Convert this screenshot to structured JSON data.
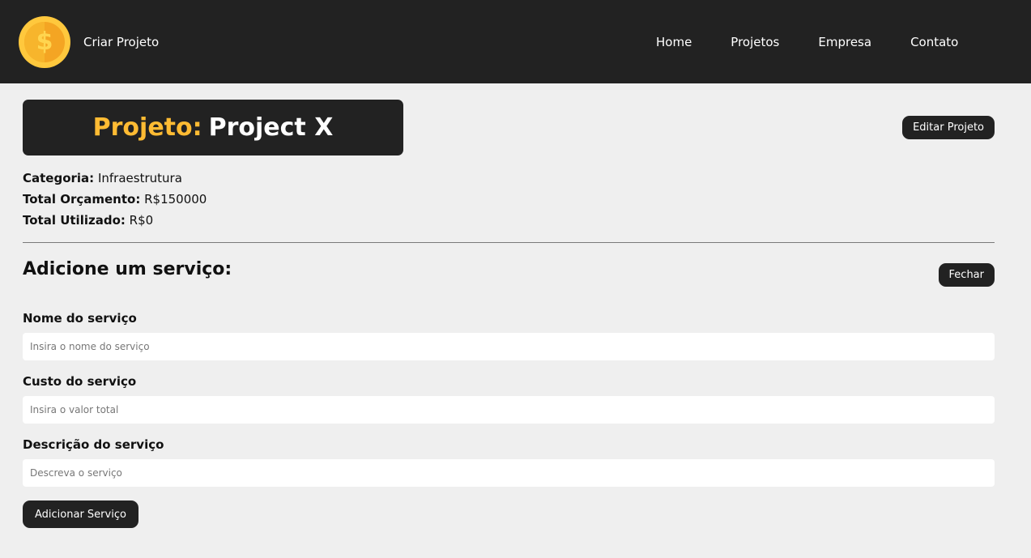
{
  "navbar": {
    "logo_symbol": "$",
    "brand_link": "Criar Projeto",
    "links": [
      "Home",
      "Projetos",
      "Empresa",
      "Contato"
    ]
  },
  "project": {
    "title_prefix": "Projeto:",
    "title_name": "Project X",
    "edit_button": "Editar Projeto",
    "category_label": "Categoria:",
    "category_value": "Infraestrutura",
    "budget_label": "Total Orçamento:",
    "budget_value": "R$150000",
    "used_label": "Total Utilizado:",
    "used_value": "R$0"
  },
  "service_form": {
    "heading": "Adicione um serviço:",
    "close_button": "Fechar",
    "name_label": "Nome do serviço",
    "name_placeholder": "Insira o nome do serviço",
    "cost_label": "Custo do serviço",
    "cost_placeholder": "Insira o valor total",
    "desc_label": "Descrição do serviço",
    "desc_placeholder": "Descreva o serviço",
    "submit_button": "Adicionar Serviço"
  },
  "colors": {
    "navbar_bg": "#222222",
    "accent": "#ffbb33",
    "page_bg": "#efefef"
  }
}
